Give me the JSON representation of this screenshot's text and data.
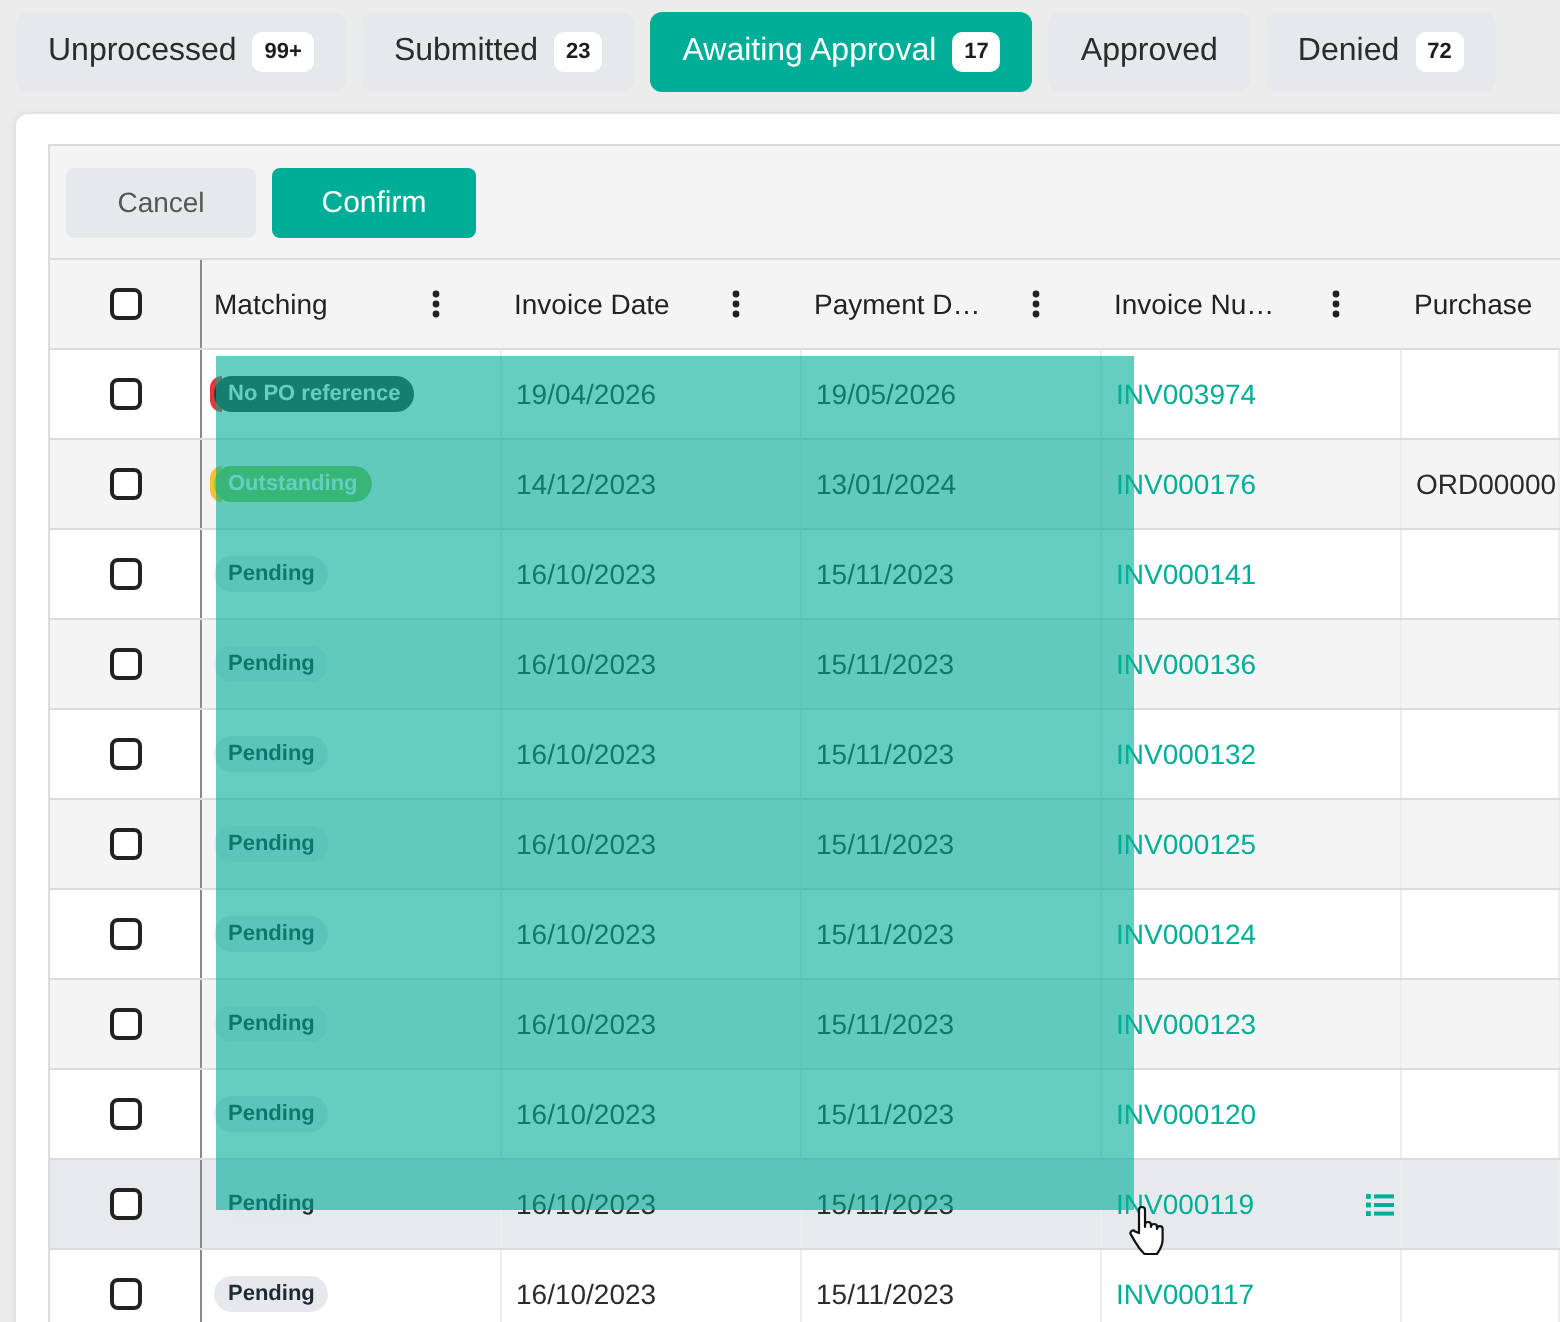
{
  "tabs": [
    {
      "label": "Unprocessed",
      "count": "99+",
      "selected": false
    },
    {
      "label": "Submitted",
      "count": "23",
      "selected": false
    },
    {
      "label": "Awaiting Approval",
      "count": "17",
      "selected": true
    },
    {
      "label": "Approved",
      "selected": false
    },
    {
      "label": "Denied",
      "count": "72",
      "selected": false
    }
  ],
  "toolbar": {
    "buttons": [
      {
        "label": "Cancel",
        "kind": "secondary"
      },
      {
        "label": "Confirm",
        "kind": "primary"
      }
    ]
  },
  "table": {
    "select_all": {
      "checked": false
    },
    "drag_selection": {
      "active": true
    },
    "columns": [
      {
        "label": "Matching",
        "menu": true
      },
      {
        "label": "Invoice Date",
        "menu": true
      },
      {
        "label": "Payment D…",
        "menu": true
      },
      {
        "label": "Invoice Nu…",
        "menu": true
      },
      {
        "label": "Purchase",
        "menu": false
      }
    ],
    "rows": [
      {
        "checked": false,
        "hovered": false,
        "matching": {
          "label": "No PO reference",
          "kind": "error",
          "color": "#e53935"
        },
        "invoice_date": "19/04/2026",
        "payment_date": "19/05/2026",
        "invoice_number": "INV003974"
      },
      {
        "checked": false,
        "hovered": false,
        "matching": {
          "label": "Outstanding",
          "kind": "warning",
          "color": "#f9c22e"
        },
        "invoice_date": "14/12/2023",
        "payment_date": "13/01/2024",
        "invoice_number": "INV000176",
        "purchase_order": "ORD00000"
      },
      {
        "checked": false,
        "hovered": false,
        "matching": {
          "label": "Pending",
          "kind": "neutral"
        },
        "invoice_date": "16/10/2023",
        "payment_date": "15/11/2023",
        "invoice_number": "INV000141"
      },
      {
        "checked": false,
        "hovered": false,
        "matching": {
          "label": "Pending",
          "kind": "neutral"
        },
        "invoice_date": "16/10/2023",
        "payment_date": "15/11/2023",
        "invoice_number": "INV000136"
      },
      {
        "checked": false,
        "hovered": false,
        "matching": {
          "label": "Pending",
          "kind": "neutral"
        },
        "invoice_date": "16/10/2023",
        "payment_date": "15/11/2023",
        "invoice_number": "INV000132"
      },
      {
        "checked": false,
        "hovered": false,
        "matching": {
          "label": "Pending",
          "kind": "neutral"
        },
        "invoice_date": "16/10/2023",
        "payment_date": "15/11/2023",
        "invoice_number": "INV000125"
      },
      {
        "checked": false,
        "hovered": false,
        "matching": {
          "label": "Pending",
          "kind": "neutral"
        },
        "invoice_date": "16/10/2023",
        "payment_date": "15/11/2023",
        "invoice_number": "INV000124"
      },
      {
        "checked": false,
        "hovered": false,
        "matching": {
          "label": "Pending",
          "kind": "neutral"
        },
        "invoice_date": "16/10/2023",
        "payment_date": "15/11/2023",
        "invoice_number": "INV000123"
      },
      {
        "checked": false,
        "hovered": false,
        "matching": {
          "label": "Pending",
          "kind": "neutral"
        },
        "invoice_date": "16/10/2023",
        "payment_date": "15/11/2023",
        "invoice_number": "INV000120"
      },
      {
        "checked": false,
        "hovered": true,
        "matching": {
          "label": "Pending",
          "kind": "neutral"
        },
        "invoice_date": "16/10/2023",
        "payment_date": "15/11/2023",
        "invoice_number": "INV000119"
      },
      {
        "checked": false,
        "hovered": false,
        "matching": {
          "label": "Pending",
          "kind": "neutral"
        },
        "invoice_date": "16/10/2023",
        "payment_date": "15/11/2023",
        "invoice_number": "INV000117"
      }
    ]
  }
}
